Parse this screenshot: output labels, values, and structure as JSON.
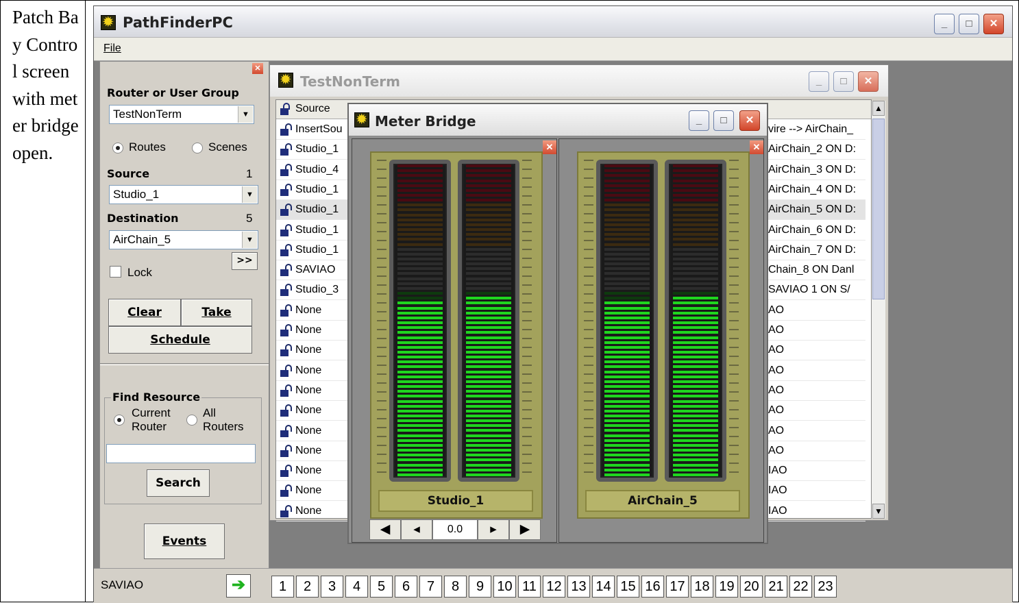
{
  "caption": "Patch Bay Control screen with meter bridge open.",
  "app": {
    "title": "PathFinderPC",
    "menu_file": "File"
  },
  "left_panel": {
    "router_group_label": "Router or User Group",
    "router_group_value": "TestNonTerm",
    "routes_label": "Routes",
    "scenes_label": "Scenes",
    "source_label": "Source",
    "source_count": "1",
    "source_value": "Studio_1",
    "destination_label": "Destination",
    "destination_count": "5",
    "destination_value": "AirChain_5",
    "more_button": ">>",
    "lock_label": "Lock",
    "clear_button": "Clear",
    "take_button": "Take",
    "schedule_button": "Schedule",
    "find_resource_label": "Find Resource",
    "current_router_label": "Current Router",
    "all_routers_label": "All Routers",
    "search_value": "",
    "search_button": "Search",
    "events_button": "Events"
  },
  "child_window": {
    "title": "TestNonTerm",
    "column_header": "Source",
    "rows": [
      {
        "left": "InsertSou",
        "right": "vire --> AirChain_"
      },
      {
        "left": "Studio_1",
        "right": "AirChain_2 ON D:"
      },
      {
        "left": "Studio_4",
        "right": "AirChain_3 ON D:"
      },
      {
        "left": "Studio_1",
        "right": "AirChain_4 ON D:"
      },
      {
        "left": "Studio_1",
        "right": "AirChain_5 ON D:"
      },
      {
        "left": "Studio_1",
        "right": "AirChain_6 ON D:"
      },
      {
        "left": "Studio_1",
        "right": "AirChain_7 ON D:"
      },
      {
        "left": "SAVIAO",
        "right": "Chain_8 ON Danl"
      },
      {
        "left": "Studio_3",
        "right": "SAVIAO 1 ON S/"
      },
      {
        "left": "None",
        "right": "AO"
      },
      {
        "left": "None",
        "right": "AO"
      },
      {
        "left": "None",
        "right": "AO"
      },
      {
        "left": "None",
        "right": "AO"
      },
      {
        "left": "None",
        "right": "AO"
      },
      {
        "left": "None",
        "right": "AO"
      },
      {
        "left": "None",
        "right": "AO"
      },
      {
        "left": "None",
        "right": "AO"
      },
      {
        "left": "None",
        "right": "IAO"
      },
      {
        "left": "None",
        "right": "IAO"
      },
      {
        "left": "None",
        "right": "IAO"
      }
    ]
  },
  "meter_bridge": {
    "title": "Meter Bridge",
    "left_channel": "Studio_1",
    "right_channel": "AirChain_5",
    "gain_value": "0.0",
    "levels": [
      0.56,
      0.57,
      0.56,
      0.57
    ]
  },
  "status_bar": {
    "current": "SAVIAO",
    "pages": [
      "1",
      "2",
      "3",
      "4",
      "5",
      "6",
      "7",
      "8",
      "9",
      "10",
      "11",
      "12",
      "13",
      "14",
      "15",
      "16",
      "17",
      "18",
      "19",
      "20",
      "21",
      "22",
      "23"
    ]
  }
}
